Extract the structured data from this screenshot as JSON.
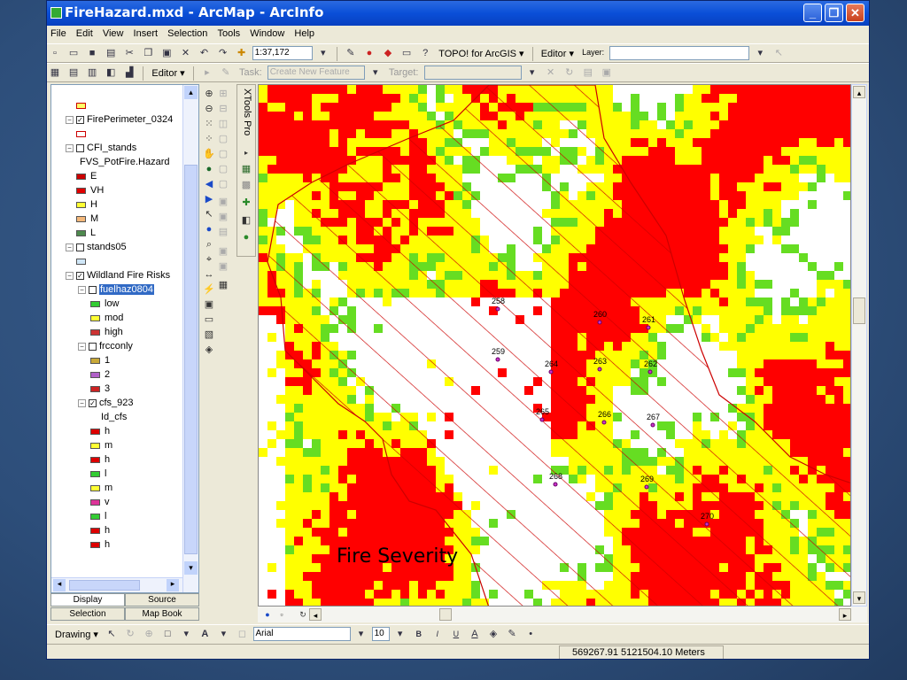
{
  "window": {
    "title": "FireHazard.mxd - ArcMap - ArcInfo",
    "minimize": "_",
    "restore": "❐",
    "close": "✕"
  },
  "menu": [
    "File",
    "Edit",
    "View",
    "Insert",
    "Selection",
    "Tools",
    "Window",
    "Help"
  ],
  "toolbar1": {
    "scale": "1:37,172",
    "topo": "TOPO! for ArcGIS ▾",
    "editor": "Editor ▾",
    "layer_label": "Layer:",
    "layer_value": ""
  },
  "toolbar2": {
    "editor": "Editor ▾",
    "task_label": "Task:",
    "task_value": "Create New Feature",
    "target_label": "Target:",
    "target_value": ""
  },
  "toc": {
    "rows": [
      {
        "t": "sw",
        "label": "",
        "fill": "#ffff66",
        "stroke": "#cc0000"
      },
      {
        "t": "layer",
        "label": "FirePerimeter_0324",
        "checked": true
      },
      {
        "t": "sw",
        "label": "",
        "fill": "#ffffff",
        "stroke": "#cc0000"
      },
      {
        "t": "layer",
        "label": "CFI_stands",
        "checked": false
      },
      {
        "t": "text",
        "label": "FVS_PotFire.Hazard"
      },
      {
        "t": "sw",
        "label": "E",
        "fill": "#cc0000"
      },
      {
        "t": "sw",
        "label": "VH",
        "fill": "#e00000"
      },
      {
        "t": "sw",
        "label": "H",
        "fill": "#ffff33"
      },
      {
        "t": "sw",
        "label": "M",
        "fill": "#f4b87a"
      },
      {
        "t": "sw",
        "label": "L",
        "fill": "#4e8a4e"
      },
      {
        "t": "layer",
        "label": "stands05",
        "checked": false
      },
      {
        "t": "sw",
        "label": "",
        "fill": "#cfe6f7"
      },
      {
        "t": "layer",
        "label": "Wildland Fire Risks",
        "checked": true
      },
      {
        "t": "sublayer",
        "label": "fuelhaz0804",
        "checked": false
      },
      {
        "t": "sw2",
        "label": "low",
        "fill": "#33cc33"
      },
      {
        "t": "sw2",
        "label": "mod",
        "fill": "#ffff33"
      },
      {
        "t": "sw2",
        "label": "high",
        "fill": "#cc3333"
      },
      {
        "t": "sublayer",
        "label": "frcconly",
        "checked": false
      },
      {
        "t": "sw2",
        "label": "1",
        "fill": "#c8a838"
      },
      {
        "t": "sw2",
        "label": "2",
        "fill": "#b060c8"
      },
      {
        "t": "sw2",
        "label": "3",
        "fill": "#cc2222"
      },
      {
        "t": "sublayer",
        "label": "cfs_923",
        "checked": true
      },
      {
        "t": "text2",
        "label": "Id_cfs"
      },
      {
        "t": "sw2",
        "label": "h",
        "fill": "#dd0000"
      },
      {
        "t": "sw2",
        "label": "m",
        "fill": "#ffff33"
      },
      {
        "t": "sw2",
        "label": "h",
        "fill": "#dd0000"
      },
      {
        "t": "sw2",
        "label": "l",
        "fill": "#33cc33"
      },
      {
        "t": "sw2",
        "label": "m",
        "fill": "#ffff33"
      },
      {
        "t": "sw2",
        "label": "v",
        "fill": "#dd3399"
      },
      {
        "t": "sw2",
        "label": "l",
        "fill": "#33cc33"
      },
      {
        "t": "sw2",
        "label": "h",
        "fill": "#dd0000"
      },
      {
        "t": "sw2",
        "label": "h",
        "fill": "#dd0000"
      }
    ]
  },
  "tabs": {
    "display": "Display",
    "source": "Source",
    "selection": "Selection",
    "mapbook": "Map Book"
  },
  "xtools": "XTools Pro",
  "map": {
    "caption": "Fire Severity",
    "plots": [
      "258",
      "259",
      "260",
      "261",
      "262",
      "263",
      "264",
      "265",
      "266",
      "267",
      "268",
      "269",
      "270"
    ]
  },
  "drawbar": {
    "drawing": "Drawing ▾",
    "font": "Arial",
    "size": "10",
    "bold": "B",
    "italic": "I",
    "underline": "U"
  },
  "status": {
    "coords": "569267.91  5121504.10 Meters"
  },
  "colors": {
    "red": "#ff0000",
    "yellow": "#ffff00",
    "green": "#66dd22",
    "title_blue": "#0a4fd8"
  }
}
